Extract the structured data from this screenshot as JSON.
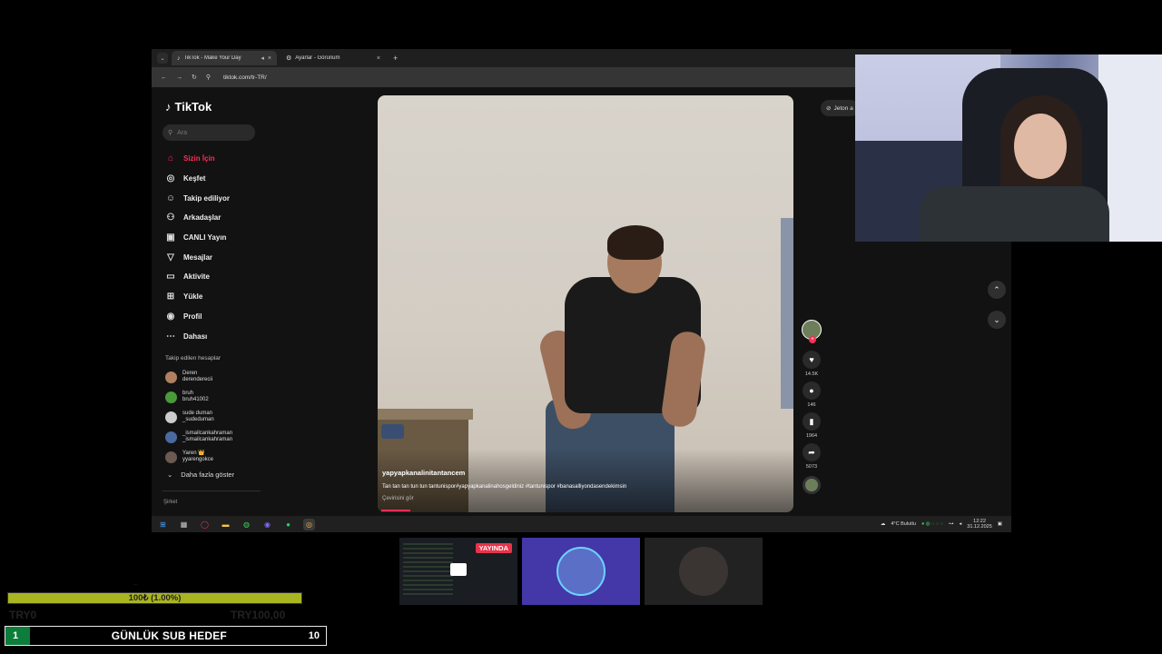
{
  "browser": {
    "tabs": [
      {
        "title": "TikTok - Make Your Day",
        "active": true
      },
      {
        "title": "Ayarlar - Görünüm",
        "active": false
      }
    ],
    "url": "tiktok.com/tr-TR/"
  },
  "tiktok": {
    "logo": "TikTok",
    "search_placeholder": "Ara",
    "nav": [
      {
        "label": "Sizin İçin",
        "icon": "home-icon",
        "active": true
      },
      {
        "label": "Keşfet",
        "icon": "compass-icon"
      },
      {
        "label": "Takip ediliyor",
        "icon": "following-icon"
      },
      {
        "label": "Arkadaşlar",
        "icon": "friends-icon"
      },
      {
        "label": "CANLI Yayın",
        "icon": "live-icon"
      },
      {
        "label": "Mesajlar",
        "icon": "messages-icon"
      },
      {
        "label": "Aktivite",
        "icon": "activity-icon"
      },
      {
        "label": "Yükle",
        "icon": "upload-icon"
      },
      {
        "label": "Profil",
        "icon": "profile-icon"
      },
      {
        "label": "Dahası",
        "icon": "more-icon"
      }
    ],
    "followed_title": "Takip edilen hesaplar",
    "followed": [
      {
        "name": "Deren",
        "handle": "derenderecii"
      },
      {
        "name": "bruh",
        "handle": "bruh41002"
      },
      {
        "name": "sude duman",
        "handle": "_sudeduman"
      },
      {
        "name": "_ismailcankahraman",
        "handle": "_ismailcankahraman"
      },
      {
        "name": "Yaren 👑",
        "handle": "yyarengokce"
      }
    ],
    "show_more": "Daha fazla göster",
    "company": "Şirket",
    "coin_button": "Jeton a",
    "video": {
      "username": "yapyapkanalinitantancem",
      "caption": "Tan tan tan tun tun tantunispor#yapyapkanalinahosgeldiniz #tantunispor #banasalliyondasendekimsin",
      "translate": "Çevirisini gör",
      "progress": 0.07
    },
    "actions": {
      "likes": "14.5K",
      "comments": "146",
      "saves": "1964",
      "shares": "5073"
    }
  },
  "taskbar": {
    "weather": "4°C Bulutlu",
    "time": "12:22",
    "date": "31.12.2025"
  },
  "stream": {
    "live_badge": "YAYINDA",
    "goal_bar": "100₺ (1.00%)",
    "goal_progress": 0.01,
    "ghost_top": "...",
    "ghost_left": "TRY0",
    "ghost_right": "TRY100,00",
    "sub_goal": {
      "start": "1",
      "title": "GÜNLÜK SUB HEDEF",
      "end": "10"
    }
  }
}
